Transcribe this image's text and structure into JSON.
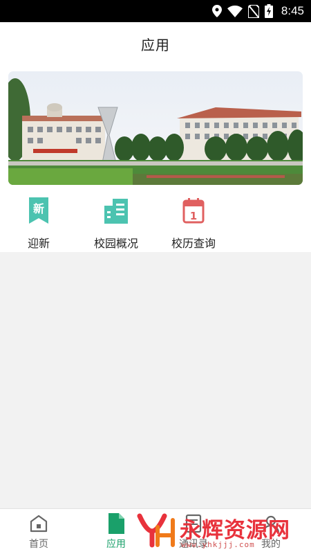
{
  "status_bar": {
    "time": "8:45",
    "icons": [
      "location-icon",
      "wifi-icon",
      "no-sim-icon",
      "battery-charging-icon"
    ]
  },
  "header": {
    "title": "应用"
  },
  "banner": {
    "image": "campus-photo"
  },
  "apps": [
    {
      "label": "迎新",
      "icon": "welcome-new-icon",
      "badge_text": "新",
      "color": "#4cc3b0"
    },
    {
      "label": "校园概况",
      "icon": "campus-building-icon",
      "color": "#4cc3b0"
    },
    {
      "label": "校历查询",
      "icon": "calendar-icon",
      "badge_text": "1",
      "color": "#e06060"
    }
  ],
  "bottom_nav": [
    {
      "label": "首页",
      "icon": "home-icon",
      "active": false
    },
    {
      "label": "应用",
      "icon": "apps-document-icon",
      "active": true
    },
    {
      "label": "通讯录",
      "icon": "contacts-icon",
      "active": false
    },
    {
      "label": "我的",
      "icon": "profile-icon",
      "active": false
    }
  ],
  "watermark": {
    "text": "永辉资源网",
    "url": "www.yhkjjj.com"
  },
  "colors": {
    "accent": "#1aa06a",
    "teal": "#4cc3b0",
    "red": "#e06060"
  }
}
